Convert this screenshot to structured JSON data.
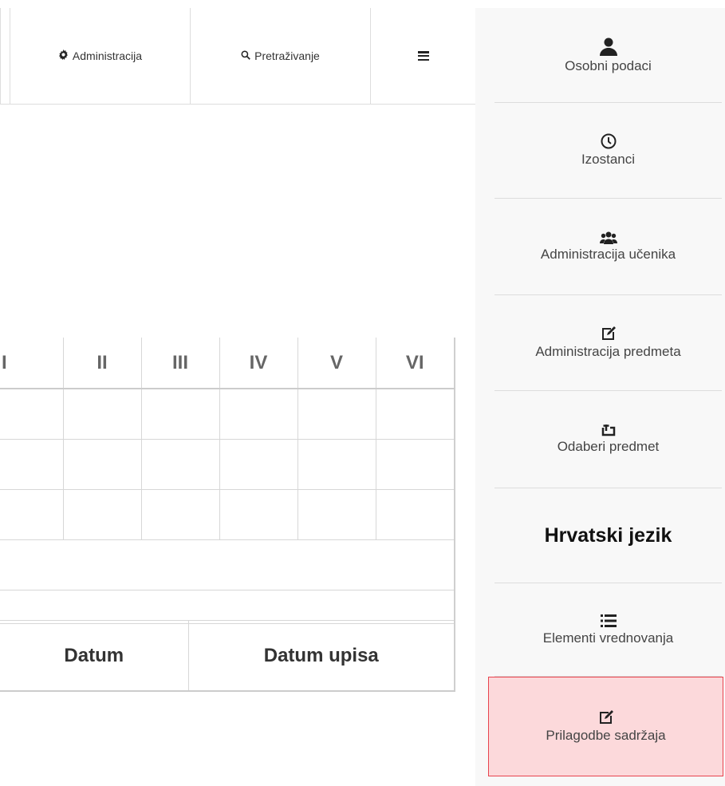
{
  "topnav": {
    "admin_label": "Administracija",
    "search_label": "Pretraživanje"
  },
  "grades_table": {
    "columns": [
      "I",
      "II",
      "III",
      "IV",
      "V",
      "VI"
    ]
  },
  "dates_table": {
    "columns": [
      "Datum",
      "Datum upisa"
    ]
  },
  "sidebar": {
    "items": [
      {
        "label": "Osobni podaci",
        "icon": "user-icon"
      },
      {
        "label": "Izostanci",
        "icon": "clock-icon"
      },
      {
        "label": "Administracija učenika",
        "icon": "users-icon"
      },
      {
        "label": "Administracija predmeta",
        "icon": "edit-icon"
      },
      {
        "label": "Odaberi predmet",
        "icon": "retweet-icon"
      },
      {
        "label": "Hrvatski jezik"
      },
      {
        "label": "Elementi vrednovanja",
        "icon": "list-icon"
      },
      {
        "label": "Prilagodbe sadržaja",
        "icon": "edit-icon"
      }
    ],
    "active_bg": "#fcd9db",
    "active_border": "#e8434d"
  }
}
